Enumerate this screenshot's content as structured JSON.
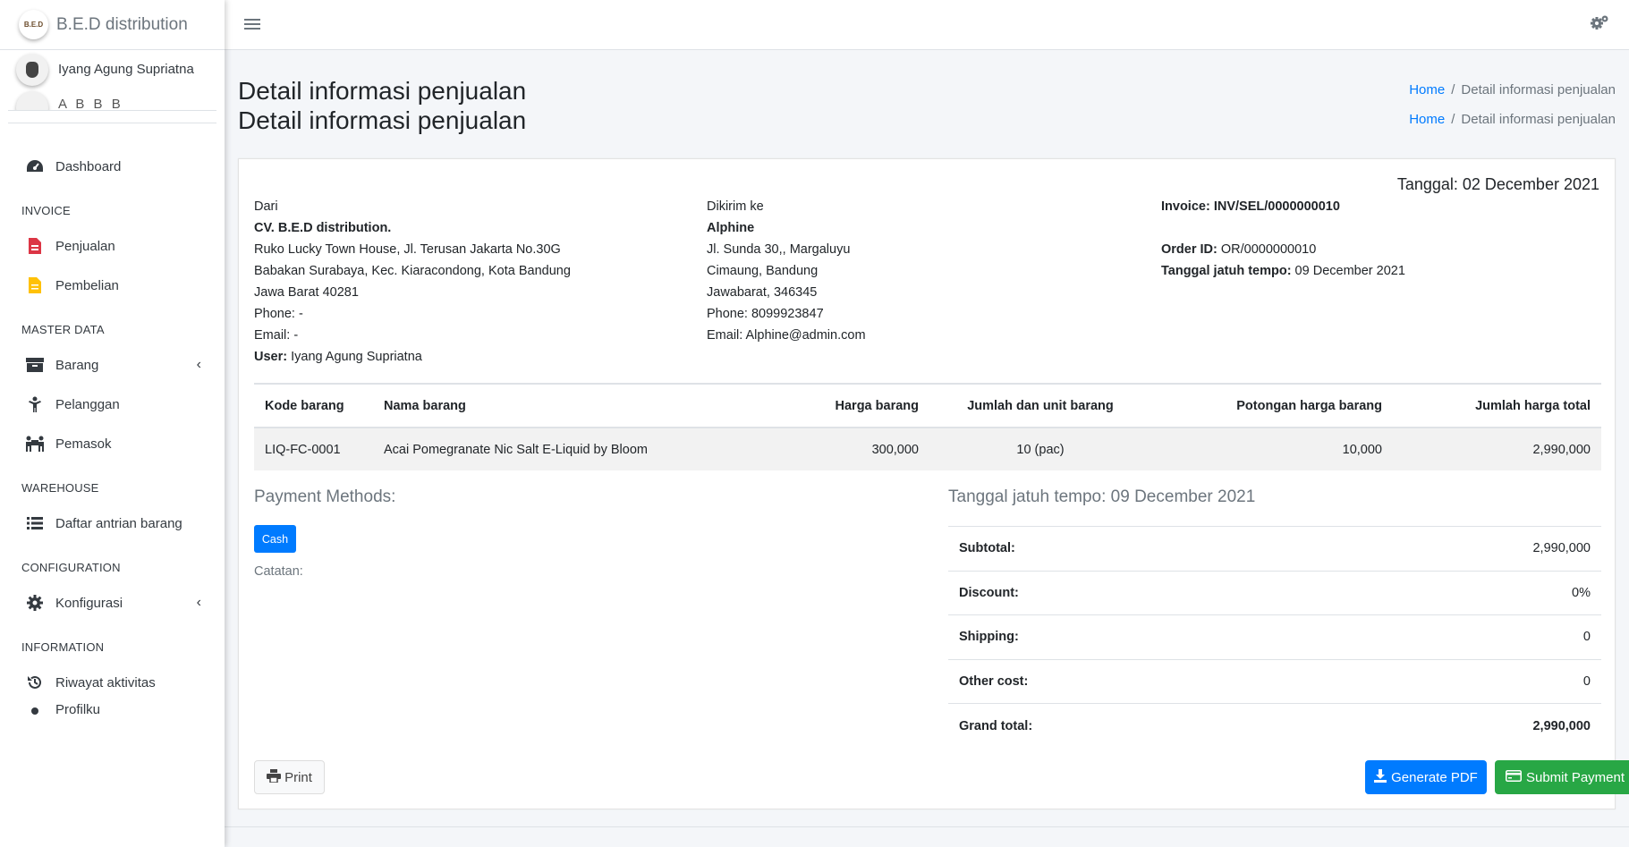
{
  "brand": {
    "logo_text": "B.E.D",
    "name": "B.E.D distribution"
  },
  "user": {
    "name": "Iyang Agung Supriatna",
    "ghost_text": "A  B  B  B"
  },
  "sidebar": {
    "items": [
      {
        "label": "Dashboard",
        "icon": "tachometer-icon"
      },
      {
        "header": "INVOICE"
      },
      {
        "label": "Penjualan",
        "icon": "file-invoice-icon",
        "color": "#dc3545"
      },
      {
        "label": "Pembelian",
        "icon": "file-icon",
        "color": "#ffc107"
      },
      {
        "header": "MASTER DATA"
      },
      {
        "label": "Barang",
        "icon": "box-icon"
      },
      {
        "label": "Pelanggan",
        "icon": "person-icon"
      },
      {
        "label": "Pemasok",
        "icon": "people-carry-icon"
      },
      {
        "header": "WAREHOUSE"
      },
      {
        "label": "Daftar antrian barang",
        "icon": "list-icon"
      },
      {
        "header": "CONFIGURATION"
      },
      {
        "label": "Konfigurasi",
        "icon": "gear-icon"
      },
      {
        "header": "INFORMATION"
      },
      {
        "label": "Riwayat aktivitas",
        "icon": "history-icon"
      },
      {
        "label": "Profilku",
        "icon": "circle-icon"
      }
    ]
  },
  "page": {
    "title": "Detail informasi penjualan",
    "breadcrumb_home": "Home",
    "breadcrumb_sep": "/",
    "breadcrumb_current": "Detail informasi penjualan"
  },
  "invoice": {
    "date": "Tanggal: 02 December 2021",
    "from": {
      "label": "Dari",
      "company": "CV. B.E.D distribution.",
      "line1": "Ruko Lucky Town House, Jl. Terusan Jakarta No.30G",
      "line2": "Babakan Surabaya, Kec. Kiaracondong, Kota Bandung",
      "line3": "Jawa Barat 40281",
      "phone": "Phone: -",
      "email": "Email: -",
      "user_label": "User:",
      "user_value": " Iyang Agung Supriatna"
    },
    "to": {
      "label": "Dikirim ke",
      "name": "Alphine",
      "line1": "Jl. Sunda 30,, Margaluyu",
      "line2": "Cimaung, Bandung",
      "line3": "Jawabarat, 346345",
      "phone": "Phone: 8099923847",
      "email": "Email: Alphine@admin.com"
    },
    "meta": {
      "invoice": "Invoice: INV/SEL/0000000010",
      "order_label": "Order ID:",
      "order_value": " OR/0000000010",
      "due_label": "Tanggal jatuh tempo:",
      "due_value": " 09 December 2021"
    },
    "table": {
      "headers": [
        "Kode barang",
        "Nama barang",
        "Harga barang",
        "Jumlah dan unit barang",
        "Potongan harga barang",
        "Jumlah harga total"
      ],
      "rows": [
        [
          "LIQ-FC-0001",
          "Acai Pomegranate Nic Salt E-Liquid by Bloom",
          "300,000",
          "10 (pac)",
          "10,000",
          "2,990,000"
        ]
      ]
    },
    "payment_title": "Payment Methods:",
    "payment_method": "Cash",
    "notes_label": "Catatan:",
    "due_title": "Tanggal jatuh tempo: 09 December 2021",
    "totals": [
      {
        "label": "Subtotal:",
        "value": "2,990,000"
      },
      {
        "label": "Discount:",
        "value": "0%"
      },
      {
        "label": "Shipping:",
        "value": "0"
      },
      {
        "label": "Other cost:",
        "value": "0"
      },
      {
        "label": "Grand total:",
        "value": "2,990,000"
      }
    ],
    "buttons": {
      "print": "Print",
      "pdf": "Generate PDF",
      "pay": "Submit Payment"
    }
  }
}
